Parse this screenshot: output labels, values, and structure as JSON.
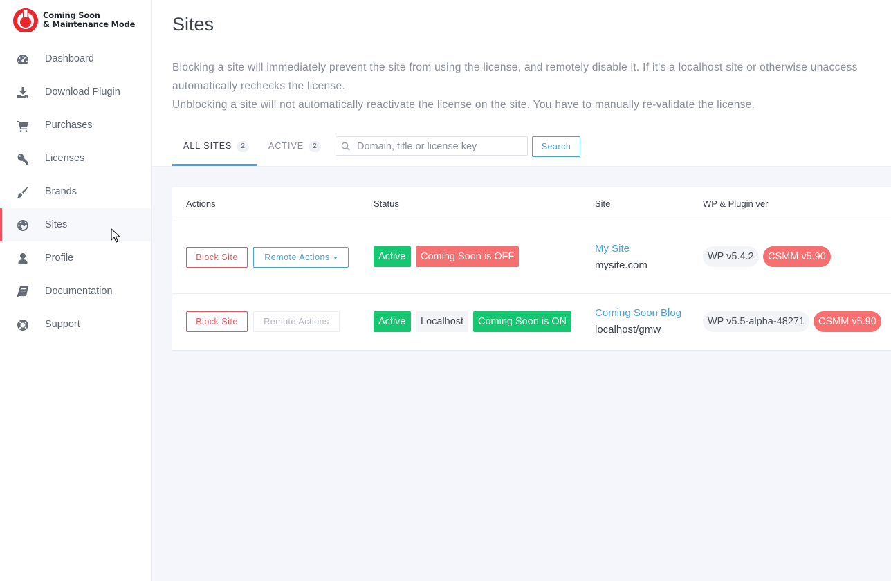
{
  "brand": {
    "line1": "Coming Soon",
    "line2": "& Maintenance Mode"
  },
  "colors": {
    "accent": "#47a4e0",
    "danger": "#f66f71",
    "success": "#17c671",
    "active_marker": "#f5515f"
  },
  "sidebar": {
    "items": [
      {
        "label": "Dashboard",
        "icon": "gauge-icon"
      },
      {
        "label": "Download Plugin",
        "icon": "download-icon"
      },
      {
        "label": "Purchases",
        "icon": "cart-icon"
      },
      {
        "label": "Licenses",
        "icon": "key-icon"
      },
      {
        "label": "Brands",
        "icon": "brush-icon"
      },
      {
        "label": "Sites",
        "icon": "globe-icon",
        "active": true
      },
      {
        "label": "Profile",
        "icon": "user-icon"
      },
      {
        "label": "Documentation",
        "icon": "book-icon"
      },
      {
        "label": "Support",
        "icon": "lifebuoy-icon"
      }
    ]
  },
  "page": {
    "title": "Sites",
    "description": [
      "Blocking a site will immediately prevent the site from using the license, and remotely disable it. If it's a localhost site or otherwise unaccess",
      "automatically rechecks the license.",
      "Unblocking a site will not automatically reactivate the license on the site. You have to manually re-validate the license."
    ]
  },
  "tabs": [
    {
      "label": "ALL SITES",
      "count": "2",
      "active": true
    },
    {
      "label": "ACTIVE",
      "count": "2"
    }
  ],
  "search": {
    "placeholder": "Domain, title or license key",
    "value": "",
    "button": "Search"
  },
  "table": {
    "headers": {
      "actions": "Actions",
      "status": "Status",
      "site": "Site",
      "versions": "WP & Plugin ver"
    },
    "rows": [
      {
        "block_label": "Block Site",
        "remote_label": "Remote Actions",
        "remote_enabled": true,
        "status": [
          "Active",
          "Coming Soon is OFF"
        ],
        "site_title": "My Site",
        "site_domain": "mysite.com",
        "wp_version": "WP v5.4.2",
        "plugin_version": "CSMM v5.90"
      },
      {
        "block_label": "Block Site",
        "remote_label": "Remote Actions",
        "remote_enabled": false,
        "status": [
          "Active",
          "Localhost",
          "Coming Soon is ON"
        ],
        "site_title": "Coming Soon Blog",
        "site_domain": "localhost/gmw",
        "wp_version": "WP v5.5-alpha-48271",
        "plugin_version": "CSMM v5.90"
      }
    ]
  }
}
